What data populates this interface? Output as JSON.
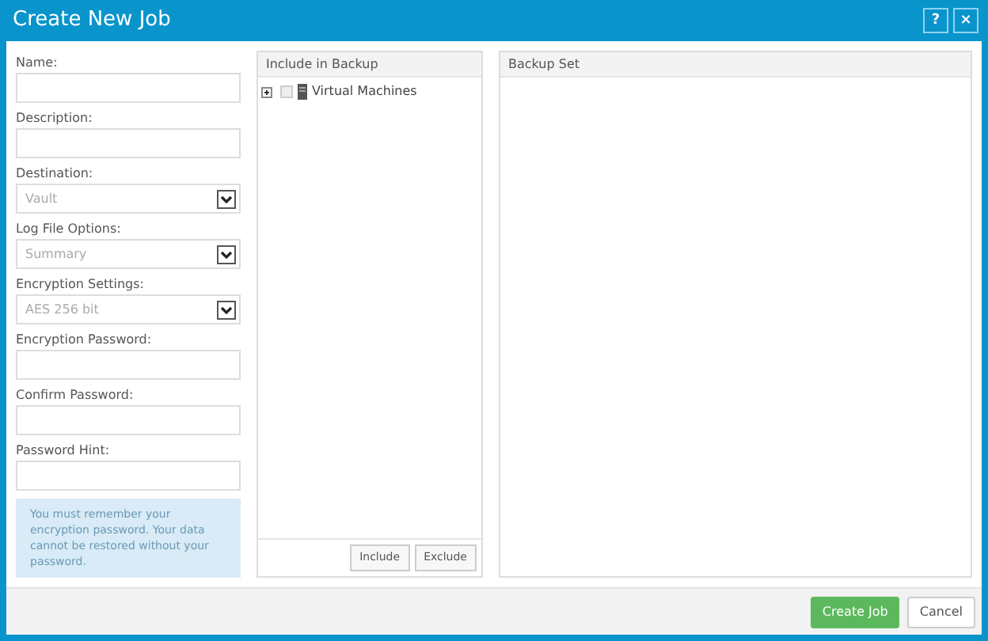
{
  "window": {
    "title": "Create New Job",
    "buttons": [
      "?",
      "×"
    ]
  },
  "form": {
    "fields": [
      {
        "label": "Name:",
        "kind": "text"
      },
      {
        "label": "Description:",
        "kind": "text"
      },
      {
        "label": "Destination:",
        "kind": "select",
        "value": "Vault"
      },
      {
        "label": "Log File Options:",
        "kind": "select",
        "value": "Summary"
      },
      {
        "label": "Encryption Settings:",
        "kind": "select",
        "value": "AES 256 bit"
      },
      {
        "label": "Encryption Password:",
        "kind": "text"
      },
      {
        "label": "Confirm Password:",
        "kind": "text"
      },
      {
        "label": "Password Hint:",
        "kind": "text"
      }
    ],
    "notice": "You must remember your encryption password. Your data cannot be restored without your password."
  },
  "include_panel": {
    "title": "Include in Backup",
    "tree": [
      {
        "label": "Virtual Machines",
        "expanded": false,
        "checked": false
      }
    ],
    "buttons": [
      "Include",
      "Exclude"
    ]
  },
  "backup_set": {
    "title": "Backup Set"
  },
  "footer": {
    "primary": "Create Job",
    "secondary": "Cancel"
  }
}
